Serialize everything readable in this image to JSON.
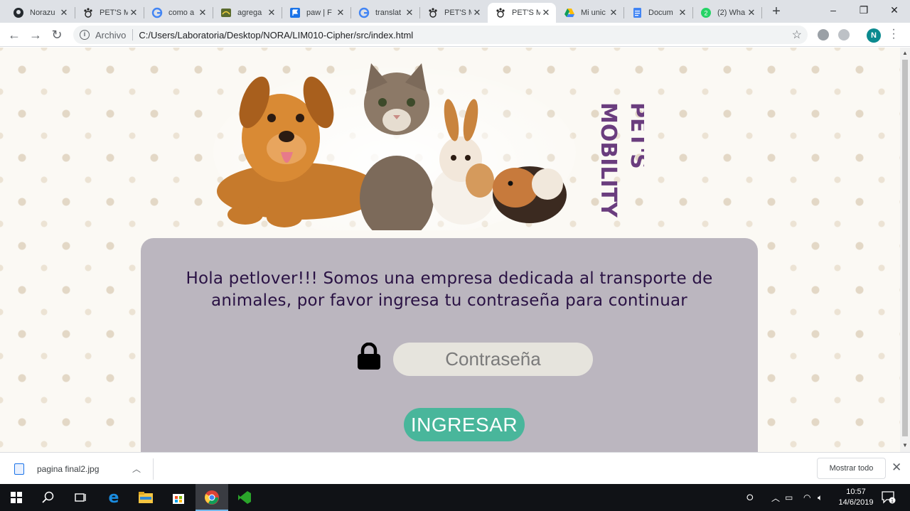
{
  "browser": {
    "tabs": [
      {
        "title": "Norazu",
        "favicon": "github-icon"
      },
      {
        "title": "PET'S M",
        "favicon": "paw-icon"
      },
      {
        "title": "como a",
        "favicon": "google-icon"
      },
      {
        "title": "agrega",
        "favicon": "webpage-icon"
      },
      {
        "title": "paw | F",
        "favicon": "flag-icon"
      },
      {
        "title": "translat",
        "favicon": "google-icon"
      },
      {
        "title": "PET'S M",
        "favicon": "paw-icon"
      },
      {
        "title": "PET'S M",
        "favicon": "paw-icon",
        "active": true
      },
      {
        "title": "Mi unic",
        "favicon": "drive-icon"
      },
      {
        "title": "Docum",
        "favicon": "docs-icon"
      },
      {
        "title": "(2) Wha",
        "favicon": "whatsapp-icon"
      }
    ],
    "address": {
      "scheme_label": "Archivo",
      "url": "C:/Users/Laboratoria/Desktop/NORA/LIM010-Cipher/src/index.html"
    },
    "profile_initial": "N"
  },
  "page": {
    "brand_line1": "PET'S",
    "brand_line2": "MOBILITY",
    "welcome": "Hola petlover!!! Somos una empresa dedicada al transporte de animales, por favor ingresa tu contraseña para continuar",
    "password_placeholder": "Contraseña",
    "password_value": "",
    "submit_label": "INGRESAR"
  },
  "downloads": {
    "file_name": "pagina final2.jpg",
    "show_all_label": "Mostrar todo"
  },
  "taskbar": {
    "time": "10:57",
    "date": "14/6/2019",
    "notification_count": "1"
  },
  "colors": {
    "card": "#bbb6bf",
    "welcome_text": "#2a1244",
    "button": "#49b69b",
    "brand": "#6a3d7e"
  }
}
